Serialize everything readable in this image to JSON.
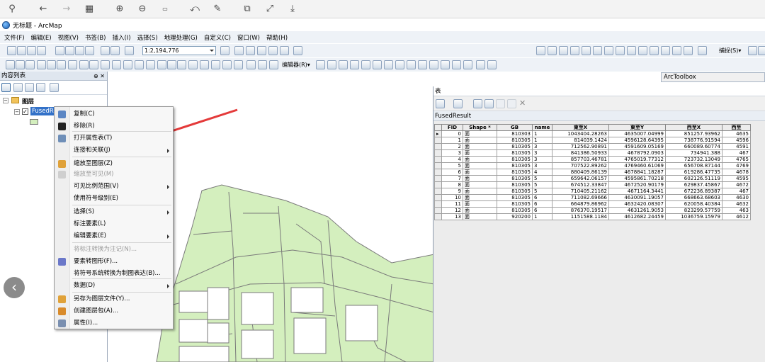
{
  "app": {
    "title": "无标题 - ArcMap",
    "menus": [
      "文件(F)",
      "编辑(E)",
      "视图(V)",
      "书签(B)",
      "插入(I)",
      "选择(S)",
      "地理处理(G)",
      "自定义(C)",
      "窗口(W)",
      "帮助(H)"
    ],
    "scale": "1:2,194,776",
    "editor_label": "编辑器(R)▾",
    "select_label": "捕捉(S)▾"
  },
  "toc": {
    "title": "内容列表",
    "pin_close": "⊕ ✕",
    "group": "图层",
    "layer": "FusedResult"
  },
  "context_menu": [
    {
      "label": "复制(C)",
      "enabled": true,
      "sub": false,
      "icon": "copy-icon",
      "color": "#5b86c4"
    },
    {
      "label": "移除(R)",
      "enabled": true,
      "sub": false,
      "icon": "remove-icon",
      "color": "#222"
    },
    {
      "label": "打开属性表(T)",
      "enabled": true,
      "sub": false,
      "icon": "table-icon",
      "color": "#6f8fb8"
    },
    {
      "label": "连接和关联(J)",
      "enabled": true,
      "sub": true,
      "icon": "",
      "color": ""
    },
    {
      "label": "缩放至图层(Z)",
      "enabled": true,
      "sub": false,
      "icon": "zoom-layer-icon",
      "color": "#e0a23a"
    },
    {
      "label": "缩放至可见(M)",
      "enabled": false,
      "sub": false,
      "icon": "zoom-visible-icon",
      "color": "#cfcfcf"
    },
    {
      "label": "可见比例范围(V)",
      "enabled": true,
      "sub": true,
      "icon": "",
      "color": ""
    },
    {
      "label": "使用符号级别(E)",
      "enabled": true,
      "sub": false,
      "icon": "",
      "color": ""
    },
    {
      "label": "选择(S)",
      "enabled": true,
      "sub": true,
      "icon": "",
      "color": ""
    },
    {
      "label": "标注要素(L)",
      "enabled": true,
      "sub": false,
      "icon": "",
      "color": ""
    },
    {
      "label": "编辑要素(E)",
      "enabled": true,
      "sub": true,
      "icon": "",
      "color": ""
    },
    {
      "label": "将标注转换为注记(N)...",
      "enabled": false,
      "sub": false,
      "icon": "",
      "color": ""
    },
    {
      "label": "要素转图形(F)...",
      "enabled": true,
      "sub": false,
      "icon": "feature-graphic-icon",
      "color": "#6b78c9"
    },
    {
      "label": "将符号系统转换为制图表达(B)...",
      "enabled": true,
      "sub": false,
      "icon": "",
      "color": ""
    },
    {
      "label": "数据(D)",
      "enabled": true,
      "sub": true,
      "icon": "",
      "color": ""
    },
    {
      "label": "另存为图层文件(Y)...",
      "enabled": true,
      "sub": false,
      "icon": "save-layer-icon",
      "color": "#e0a23a"
    },
    {
      "label": "创建图层包(A)...",
      "enabled": true,
      "sub": false,
      "icon": "layer-package-icon",
      "color": "#d98b2b"
    },
    {
      "label": "属性(I)...",
      "enabled": true,
      "sub": false,
      "icon": "properties-icon",
      "color": "#7a8fb0"
    }
  ],
  "arctoolbox": {
    "title": "ArcToolbox"
  },
  "table": {
    "window_title": "表",
    "layer_name": "FusedResult",
    "columns": [
      "FID",
      "Shape *",
      "GB",
      "name",
      "東至X",
      "東至Y",
      "西至X",
      "西至"
    ],
    "rows": [
      [
        "0",
        "面",
        "810303",
        "1",
        "1043404.28263",
        "4635007.04999",
        "851257.93962",
        "4635"
      ],
      [
        "1",
        "面",
        "810305",
        "1",
        "814039.1424",
        "4596128.64395",
        "738776.91594",
        "4596"
      ],
      [
        "2",
        "面",
        "810305",
        "3",
        "712562.90891",
        "4591609.05169",
        "660089.60774",
        "4591"
      ],
      [
        "3",
        "面",
        "810305",
        "3",
        "841386.50933",
        "4678792.0903",
        "734941.388",
        "467"
      ],
      [
        "4",
        "面",
        "810305",
        "3",
        "857703.46781",
        "4765019.77312",
        "723732.13049",
        "4765"
      ],
      [
        "5",
        "面",
        "810305",
        "3",
        "707522.89262",
        "4769460.61069",
        "656708.87144",
        "4769"
      ],
      [
        "6",
        "面",
        "810305",
        "4",
        "880409.86139",
        "4678841.18287",
        "619286.47735",
        "4678"
      ],
      [
        "7",
        "面",
        "810305",
        "5",
        "659642.06157",
        "4595861.70218",
        "602126.51119",
        "4595"
      ],
      [
        "8",
        "面",
        "810305",
        "5",
        "674512.33847",
        "4672520.90179",
        "629837.45867",
        "4672"
      ],
      [
        "9",
        "面",
        "810305",
        "5",
        "710405.21162",
        "4671164.3441",
        "672236.89387",
        "467"
      ],
      [
        "10",
        "面",
        "810305",
        "6",
        "711082.69666",
        "4630091.19057",
        "668663.68603",
        "4630"
      ],
      [
        "11",
        "面",
        "810305",
        "6",
        "664879.86962",
        "4632420.08307",
        "620058.40384",
        "4632"
      ],
      [
        "12",
        "面",
        "810305",
        "6",
        "876370.19517",
        "4631261.9053",
        "823299.57759",
        "463"
      ],
      [
        "13",
        "面",
        "920200",
        "1",
        "1151588.1184",
        "4612682.24459",
        "1036759.15979",
        "4612"
      ]
    ]
  },
  "colors": {
    "map_fill": "#d4efbe",
    "map_line": "#7a7a7a",
    "arrow": "#e43a3a"
  }
}
